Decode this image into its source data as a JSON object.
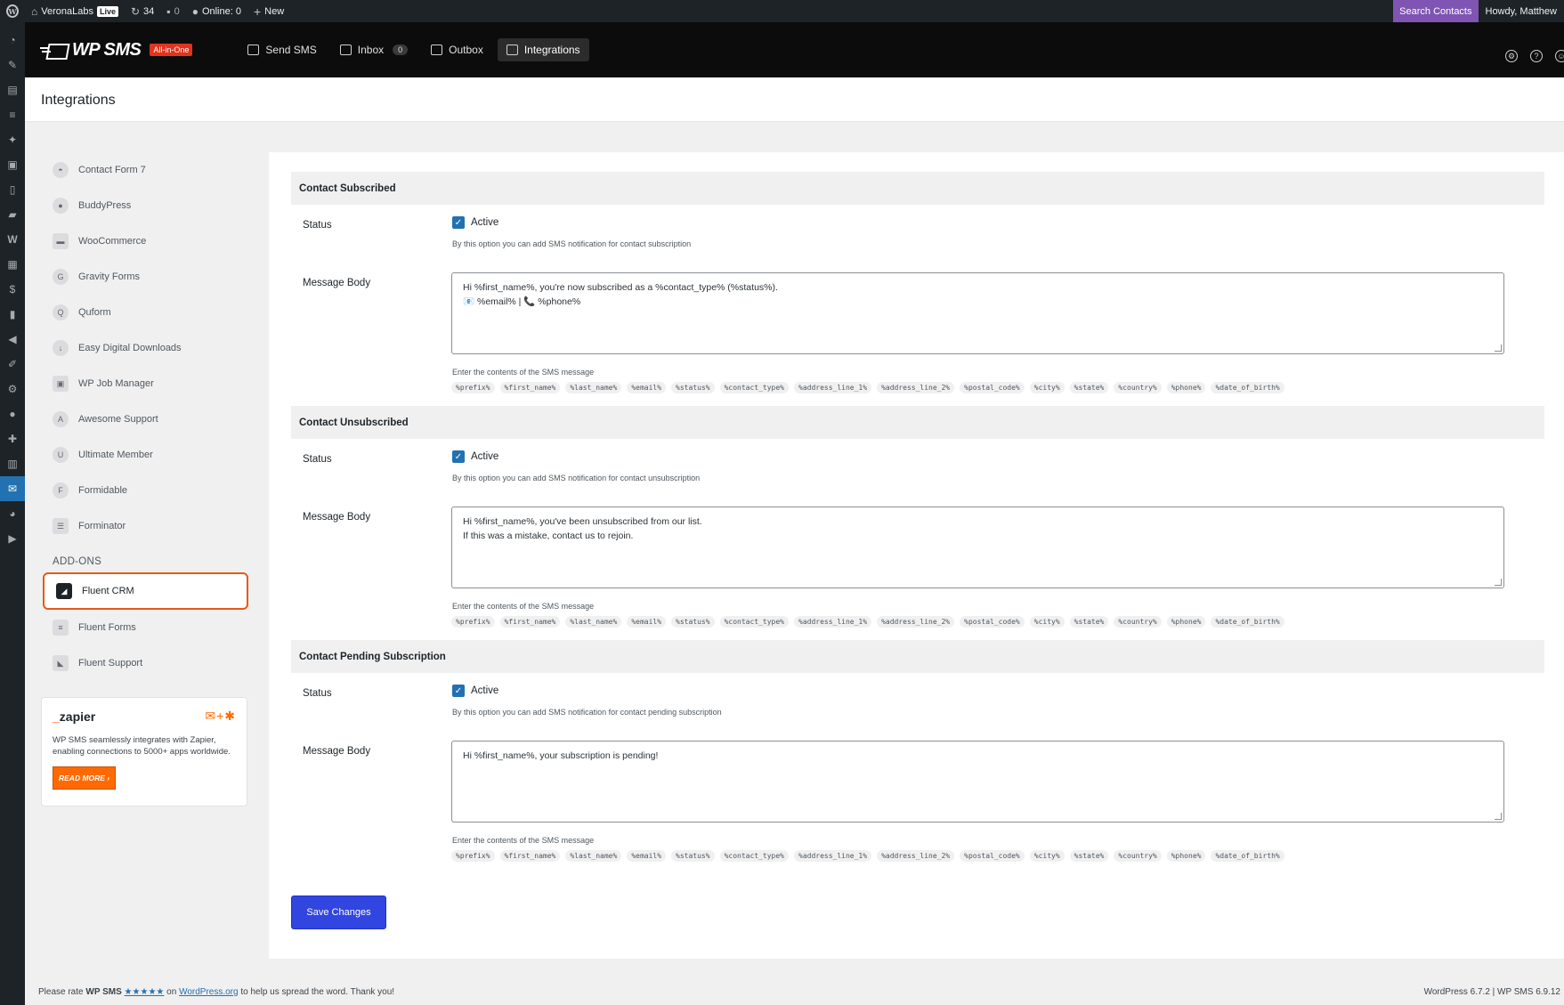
{
  "admin_bar": {
    "site_name": "VeronaLabs",
    "live_badge": "Live",
    "updates_count": "34",
    "comments_count": "0",
    "online": "Online: 0",
    "new_label": "New",
    "search_contacts": "Search Contacts",
    "howdy": "Howdy, Matthew"
  },
  "plugin_header": {
    "logo_text": "WP SMS",
    "logo_badge": "All-in-One",
    "nav": [
      {
        "label": "Send SMS",
        "icon": "send-sms-icon"
      },
      {
        "label": "Inbox",
        "icon": "inbox-icon",
        "badge": "0"
      },
      {
        "label": "Outbox",
        "icon": "outbox-icon"
      },
      {
        "label": "Integrations",
        "icon": "integrations-icon",
        "active": true
      }
    ]
  },
  "page_title": "Integrations",
  "sidenav": {
    "items": [
      {
        "label": "Contact Form 7",
        "icon": "contact-form-7-icon"
      },
      {
        "label": "BuddyPress",
        "icon": "buddypress-icon"
      },
      {
        "label": "WooCommerce",
        "icon": "woocommerce-icon"
      },
      {
        "label": "Gravity Forms",
        "icon": "gravity-forms-icon"
      },
      {
        "label": "Quform",
        "icon": "quform-icon"
      },
      {
        "label": "Easy Digital Downloads",
        "icon": "edd-icon"
      },
      {
        "label": "WP Job Manager",
        "icon": "wp-job-manager-icon"
      },
      {
        "label": "Awesome Support",
        "icon": "awesome-support-icon"
      },
      {
        "label": "Ultimate Member",
        "icon": "ultimate-member-icon"
      },
      {
        "label": "Formidable",
        "icon": "formidable-icon"
      },
      {
        "label": "Forminator",
        "icon": "forminator-icon"
      }
    ],
    "addons_heading": "ADD-ONS",
    "addons": [
      {
        "label": "Fluent CRM",
        "icon": "fluent-crm-icon",
        "selected": true
      },
      {
        "label": "Fluent Forms",
        "icon": "fluent-forms-icon"
      },
      {
        "label": "Fluent Support",
        "icon": "fluent-support-icon"
      }
    ],
    "zapier": {
      "logo": "zapier",
      "description": "WP SMS seamlessly integrates with Zapier, enabling connections to 5000+ apps worldwide.",
      "button": "READ MORE ›"
    }
  },
  "sections": [
    {
      "title": "Contact Subscribed",
      "status_label": "Status",
      "checkbox_label": "Active",
      "hint": "By this option you can add SMS notification for contact subscription",
      "message_label": "Message Body",
      "message": "Hi %first_name%, you're now subscribed as a %contact_type% (%status%).\n📧 %email% | 📞 %phone%",
      "contents_hint": "Enter the contents of the SMS message"
    },
    {
      "title": "Contact Unsubscribed",
      "status_label": "Status",
      "checkbox_label": "Active",
      "hint": "By this option you can add SMS notification for contact unsubscription",
      "message_label": "Message Body",
      "message": "Hi %first_name%, you've been unsubscribed from our list.\nIf this was a mistake, contact us to rejoin.",
      "contents_hint": "Enter the contents of the SMS message"
    },
    {
      "title": "Contact Pending Subscription",
      "status_label": "Status",
      "checkbox_label": "Active",
      "hint": "By this option you can add SMS notification for contact pending subscription",
      "message_label": "Message Body",
      "message": "Hi %first_name%, your subscription is pending!",
      "contents_hint": "Enter the contents of the SMS message"
    }
  ],
  "tags": [
    "%prefix%",
    "%first_name%",
    "%last_name%",
    "%email%",
    "%status%",
    "%contact_type%",
    "%address_line_1%",
    "%address_line_2%",
    "%postal_code%",
    "%city%",
    "%state%",
    "%country%",
    "%phone%",
    "%date_of_birth%"
  ],
  "save_button": "Save Changes",
  "footer": {
    "rate_prefix": "Please rate",
    "plugin_name": "WP SMS",
    "stars": "★★★★★",
    "on": "on",
    "wporg": "WordPress.org",
    "rate_suffix": "to help us spread the word. Thank you!",
    "version": "WordPress 6.7.2 | WP SMS 6.9.12"
  }
}
